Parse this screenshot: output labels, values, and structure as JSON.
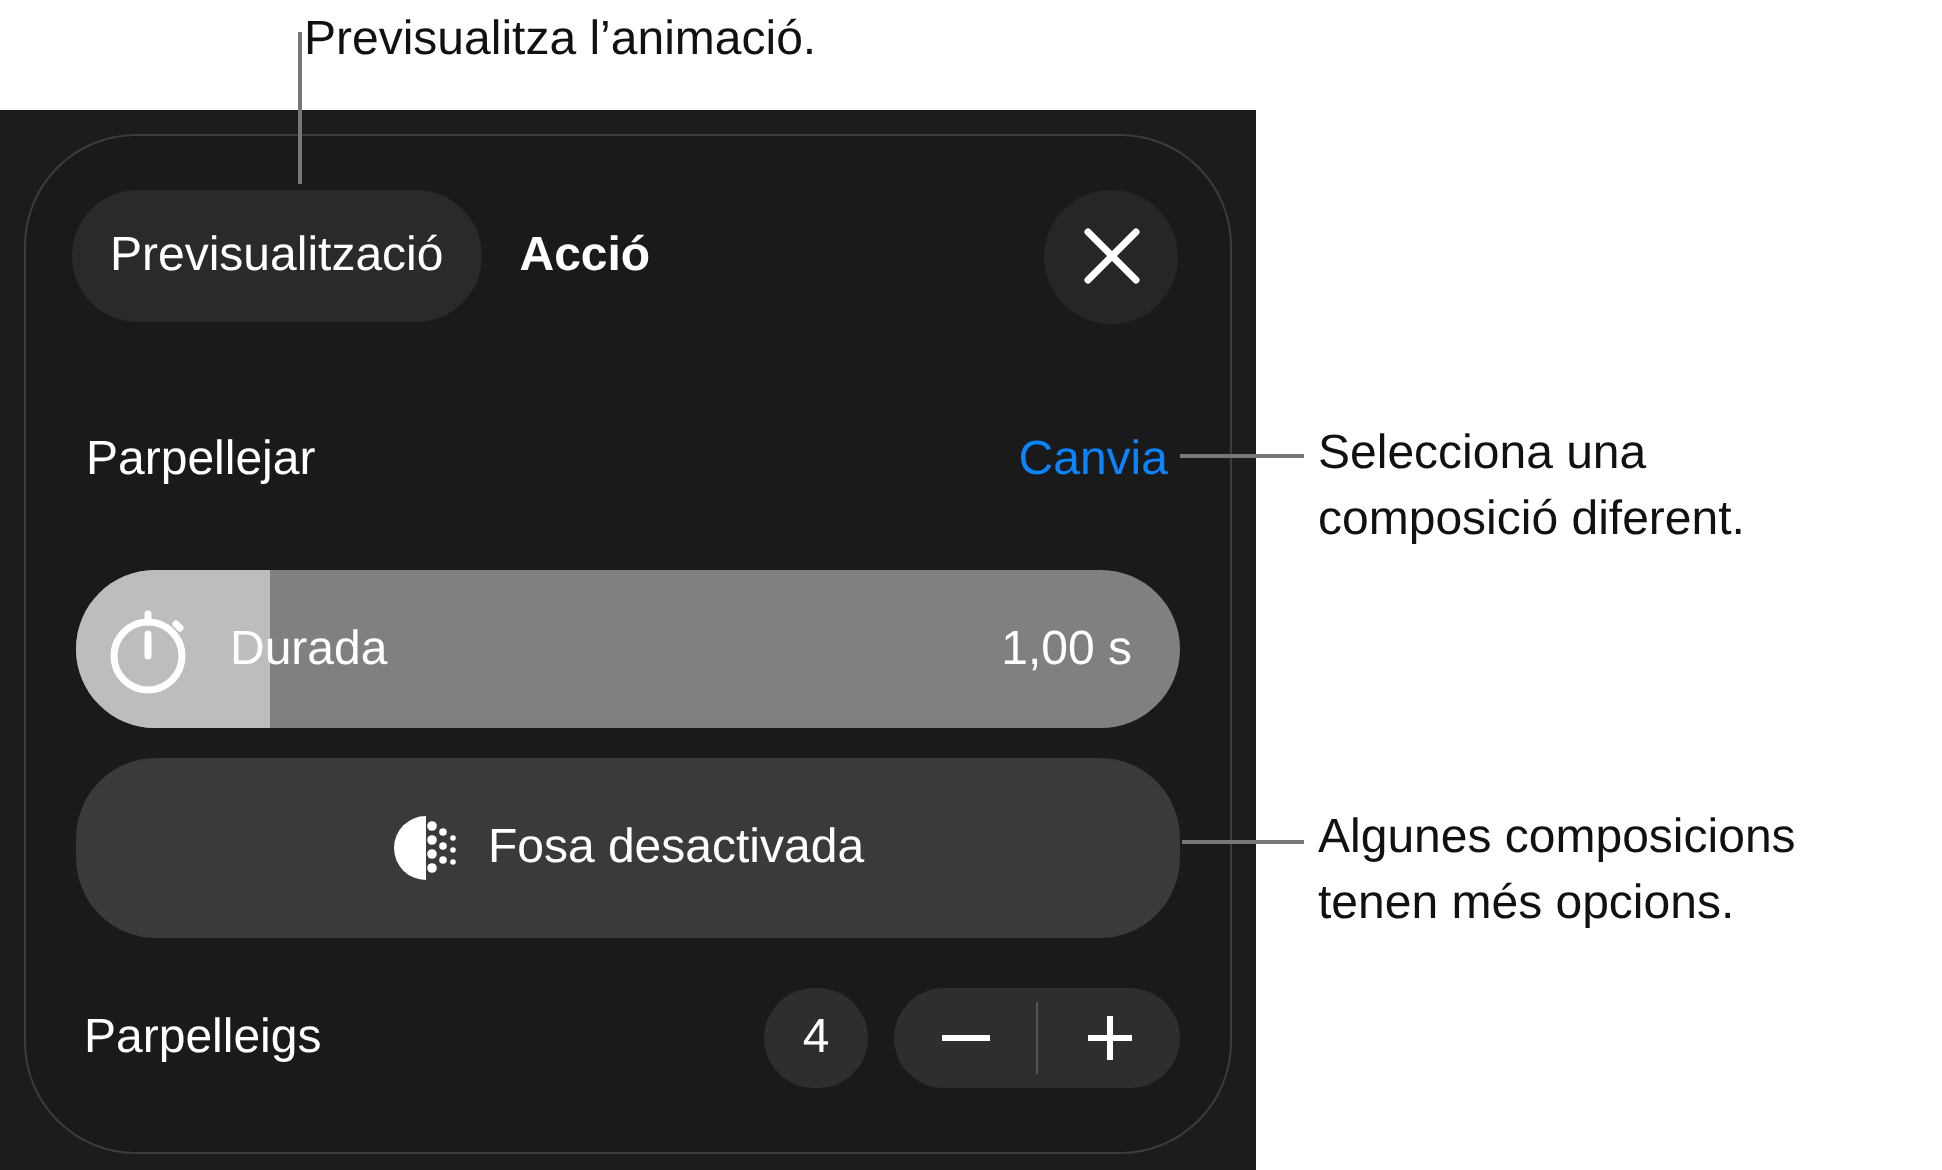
{
  "callouts": [
    {
      "kind": "top",
      "text": "Previsualitza l’animació."
    },
    {
      "kind": "right-upper",
      "text": "Selecciona una\ncomposició diferent."
    },
    {
      "kind": "right-lower",
      "text": "Algunes composicions\ntenen més opcions."
    }
  ],
  "panel": {
    "tabs": [
      {
        "label": "Previsualització",
        "selected": true
      },
      {
        "label": "Acció",
        "selected": false
      }
    ],
    "effect": {
      "name": "Parpellejar",
      "change_link": "Canvia"
    },
    "duration": {
      "label": "Durada",
      "value": "1,00 s",
      "level": 0.175
    },
    "blur_button": "Fosa desactivada",
    "count": {
      "label": "Parpelleigs",
      "value": "4"
    }
  }
}
